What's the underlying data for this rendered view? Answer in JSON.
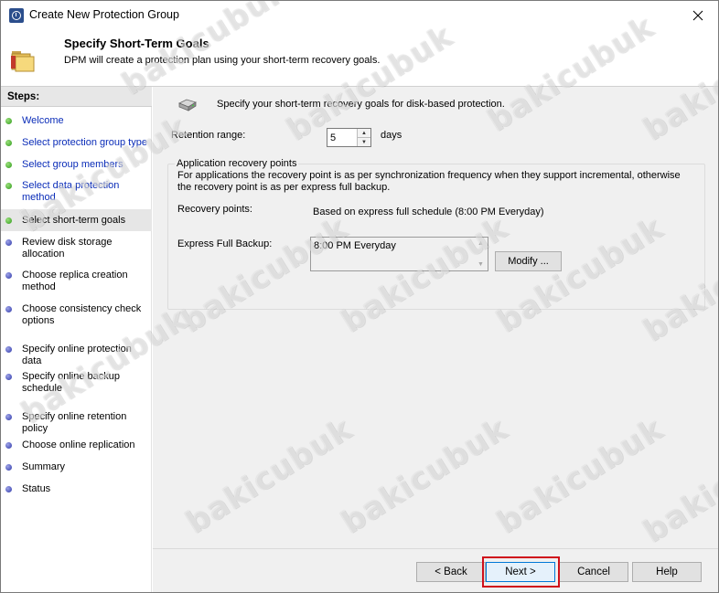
{
  "window": {
    "title": "Create New Protection Group"
  },
  "header": {
    "title": "Specify Short-Term Goals",
    "description": "DPM will create a protection plan using your short-term recovery goals."
  },
  "steps": {
    "heading": "Steps:",
    "items": [
      {
        "label": "Welcome",
        "state": "done"
      },
      {
        "label": "Select protection group type",
        "state": "done"
      },
      {
        "label": "Select group members",
        "state": "done"
      },
      {
        "label": "Select data protection method",
        "state": "done"
      },
      {
        "label": "Select short-term goals",
        "state": "current"
      },
      {
        "label": "Review disk storage allocation",
        "state": "pending"
      },
      {
        "label": "Choose replica creation method",
        "state": "pending"
      },
      {
        "label": "Choose consistency check options",
        "state": "pending"
      },
      {
        "label": "Specify online protection data",
        "state": "pending"
      },
      {
        "label": "Specify online backup schedule",
        "state": "pending"
      },
      {
        "label": "Specify online retention policy",
        "state": "pending"
      },
      {
        "label": "Choose online replication",
        "state": "pending"
      },
      {
        "label": "Summary",
        "state": "pending"
      },
      {
        "label": "Status",
        "state": "pending"
      }
    ]
  },
  "content": {
    "intro": "Specify your short-term recovery goals for disk-based protection.",
    "retention_label": "Retention range:",
    "retention_value": "5",
    "retention_unit": "days",
    "group_title": "Application recovery points",
    "group_description": "For applications the recovery point is as per synchronization frequency when they support incremental, otherwise the recovery point is as per express full backup.",
    "recovery_points_label": "Recovery points:",
    "recovery_points_value": "Based on express full schedule (8:00 PM Everyday)",
    "express_full_label": "Express Full Backup:",
    "express_full_value": "8:00 PM Everyday",
    "modify_label": "Modify ..."
  },
  "footer": {
    "back_label": "< Back",
    "next_label": "Next >",
    "cancel_label": "Cancel",
    "help_label": "Help"
  },
  "watermark": {
    "text": "bakicubuk"
  },
  "colors": {
    "accent_border": "#0078d7",
    "highlight": "#d0101b",
    "step_done_link": "#0a2cb8",
    "step_done_dot": "#2f9a1a",
    "step_pending_dot": "#2d37a8"
  }
}
